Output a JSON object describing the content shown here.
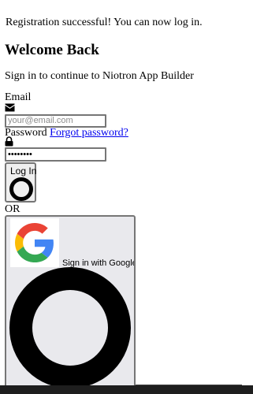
{
  "alert": {
    "success_message": "Registration successful! You can now log in."
  },
  "header": {
    "title": "Welcome Back",
    "subtitle": "Sign in to continue to Niotron App Builder"
  },
  "form": {
    "email_label": "Email",
    "email_placeholder": "your@email.com",
    "email_value": "",
    "email_icon": "envelope-icon",
    "password_label": "Password",
    "forgot_password_link": "Forgot password?",
    "password_value": "********",
    "password_icon": "lock-icon",
    "login_button_label": "Log In",
    "divider_text": "OR",
    "google_button_label": "Sign in with Google"
  },
  "colors": {
    "link": "#0000ee",
    "google_blue": "#4285F4",
    "google_red": "#EA4335",
    "google_yellow": "#FBBC05",
    "google_green": "#34A853"
  }
}
